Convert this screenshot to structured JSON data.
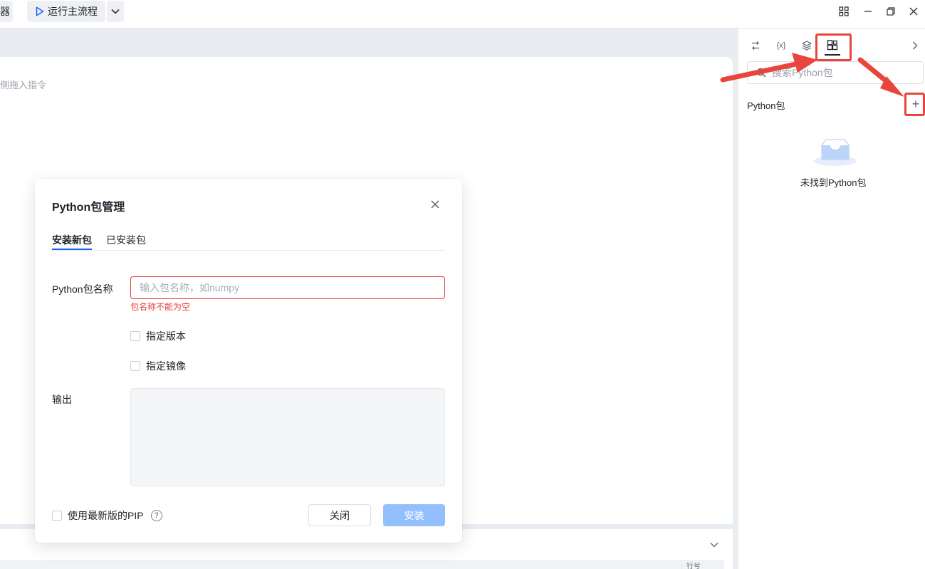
{
  "topbar": {
    "left_chip_label": "器",
    "run_label": "运行主流程",
    "colors": {
      "run_icon": "#1664ff"
    }
  },
  "canvas": {
    "hint": "侧拖入指令",
    "bottom_col_label": "行号"
  },
  "right_panel": {
    "tabs": [
      "flow-icon",
      "variable-icon",
      "layers-icon",
      "package-icon"
    ],
    "variable_tab_label": "{x}",
    "search_placeholder": "搜索Python包",
    "section_title": "Python包",
    "add_label": "+",
    "empty_text": "未找到Python包"
  },
  "dialog": {
    "title": "Python包管理",
    "tabs": [
      {
        "label": "安装新包",
        "active": true
      },
      {
        "label": "已安装包",
        "active": false
      }
    ],
    "package_name_label": "Python包名称",
    "package_name_placeholder": "输入包名称，如numpy",
    "package_name_value": "",
    "error_text": "包名称不能为空",
    "specify_version_label": "指定版本",
    "specify_mirror_label": "指定镜像",
    "output_label": "输出",
    "use_latest_pip_label": "使用最新版的PIP",
    "help_label": "?",
    "close_button": "关闭",
    "install_button": "安装"
  },
  "annotations": {
    "highlight_color": "#e8453c"
  }
}
